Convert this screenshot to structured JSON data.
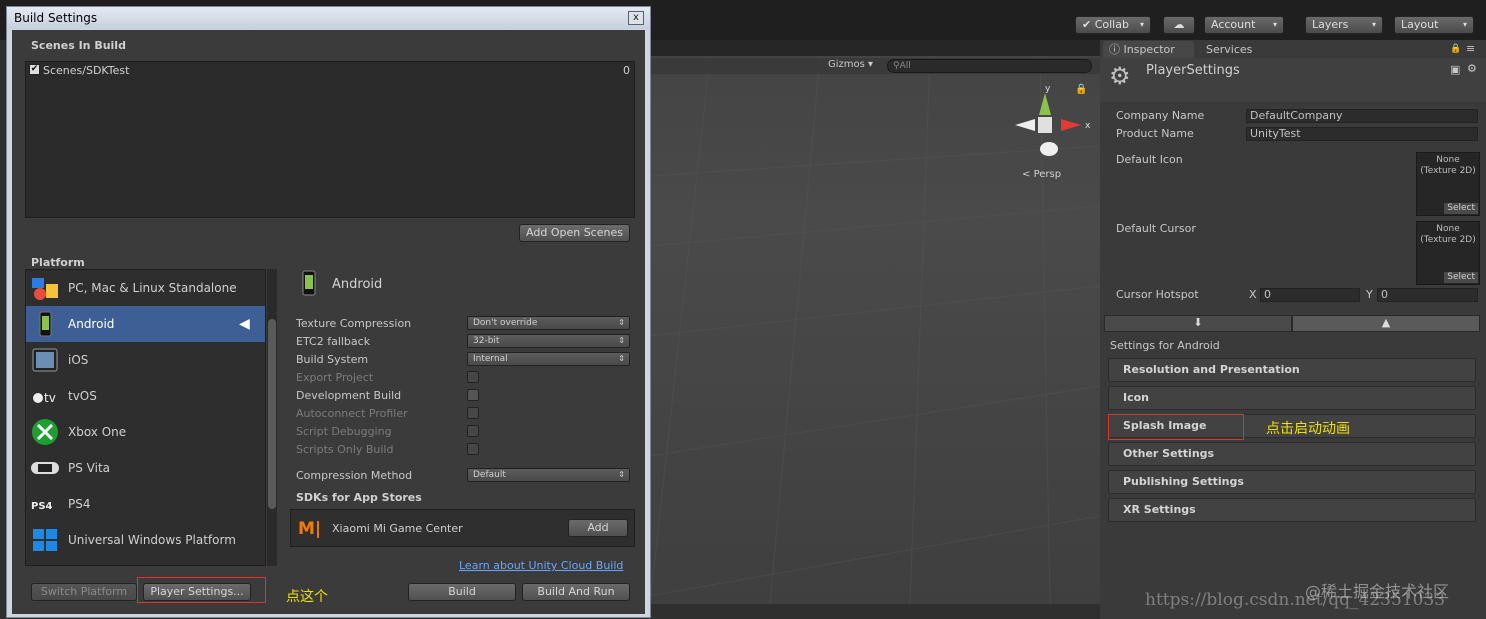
{
  "toolbar": {
    "collab": "Collab",
    "account": "Account",
    "layers": "Layers",
    "layout": "Layout"
  },
  "scene": {
    "gizmos": "Gizmos",
    "search_placeholder": "All",
    "persp": "Persp",
    "axis_y": "y",
    "axis_x": "x"
  },
  "inspector": {
    "tabs": [
      "Inspector",
      "Services"
    ],
    "title": "PlayerSettings",
    "company_name_label": "Company Name",
    "company_name_value": "DefaultCompany",
    "product_name_label": "Product Name",
    "product_name_value": "UnityTest",
    "default_icon_label": "Default Icon",
    "default_cursor_label": "Default Cursor",
    "texture_slot_text": "None (Texture 2D)",
    "select_label": "Select",
    "cursor_hotspot_label": "Cursor Hotspot",
    "hotspot_x_label": "X",
    "hotspot_x_value": "0",
    "hotspot_y_label": "Y",
    "hotspot_y_value": "0",
    "settings_for": "Settings for Android",
    "sections": [
      "Resolution and Presentation",
      "Icon",
      "Splash Image",
      "Other Settings",
      "Publishing Settings",
      "XR Settings"
    ],
    "splash_annotation": "点击启动动画"
  },
  "build_window": {
    "title": "Build Settings",
    "close": "x",
    "scenes_header": "Scenes In Build",
    "scenes": [
      {
        "name": "Scenes/SDKTest",
        "index": "0",
        "checked": true
      }
    ],
    "add_open_scenes": "Add Open Scenes",
    "platform_header": "Platform",
    "platforms": [
      "PC, Mac & Linux Standalone",
      "Android",
      "iOS",
      "tvOS",
      "Xbox One",
      "PS Vita",
      "PS4",
      "Universal Windows Platform"
    ],
    "selected_platform": "Android",
    "options": {
      "texture_compression_label": "Texture Compression",
      "texture_compression_value": "Don't override",
      "etc2_label": "ETC2 fallback",
      "etc2_value": "32-bit",
      "build_system_label": "Build System",
      "build_system_value": "Internal",
      "export_project": "Export Project",
      "development_build": "Development Build",
      "autoconnect_profiler": "Autoconnect Profiler",
      "script_debugging": "Script Debugging",
      "scripts_only_build": "Scripts Only Build",
      "compression_label": "Compression Method",
      "compression_value": "Default",
      "sdks_header": "SDKs for App Stores",
      "sdk_name": "Xiaomi Mi Game Center",
      "add": "Add"
    },
    "cloud_link": "Learn about Unity Cloud Build",
    "switch_platform": "Switch Platform",
    "player_settings": "Player Settings...",
    "build": "Build",
    "build_and_run": "Build And Run",
    "player_annotation": "点这个"
  },
  "watermark": "@稀土掘金技术社区",
  "watermark_url": "https://blog.csdn.net/qq_42351033"
}
